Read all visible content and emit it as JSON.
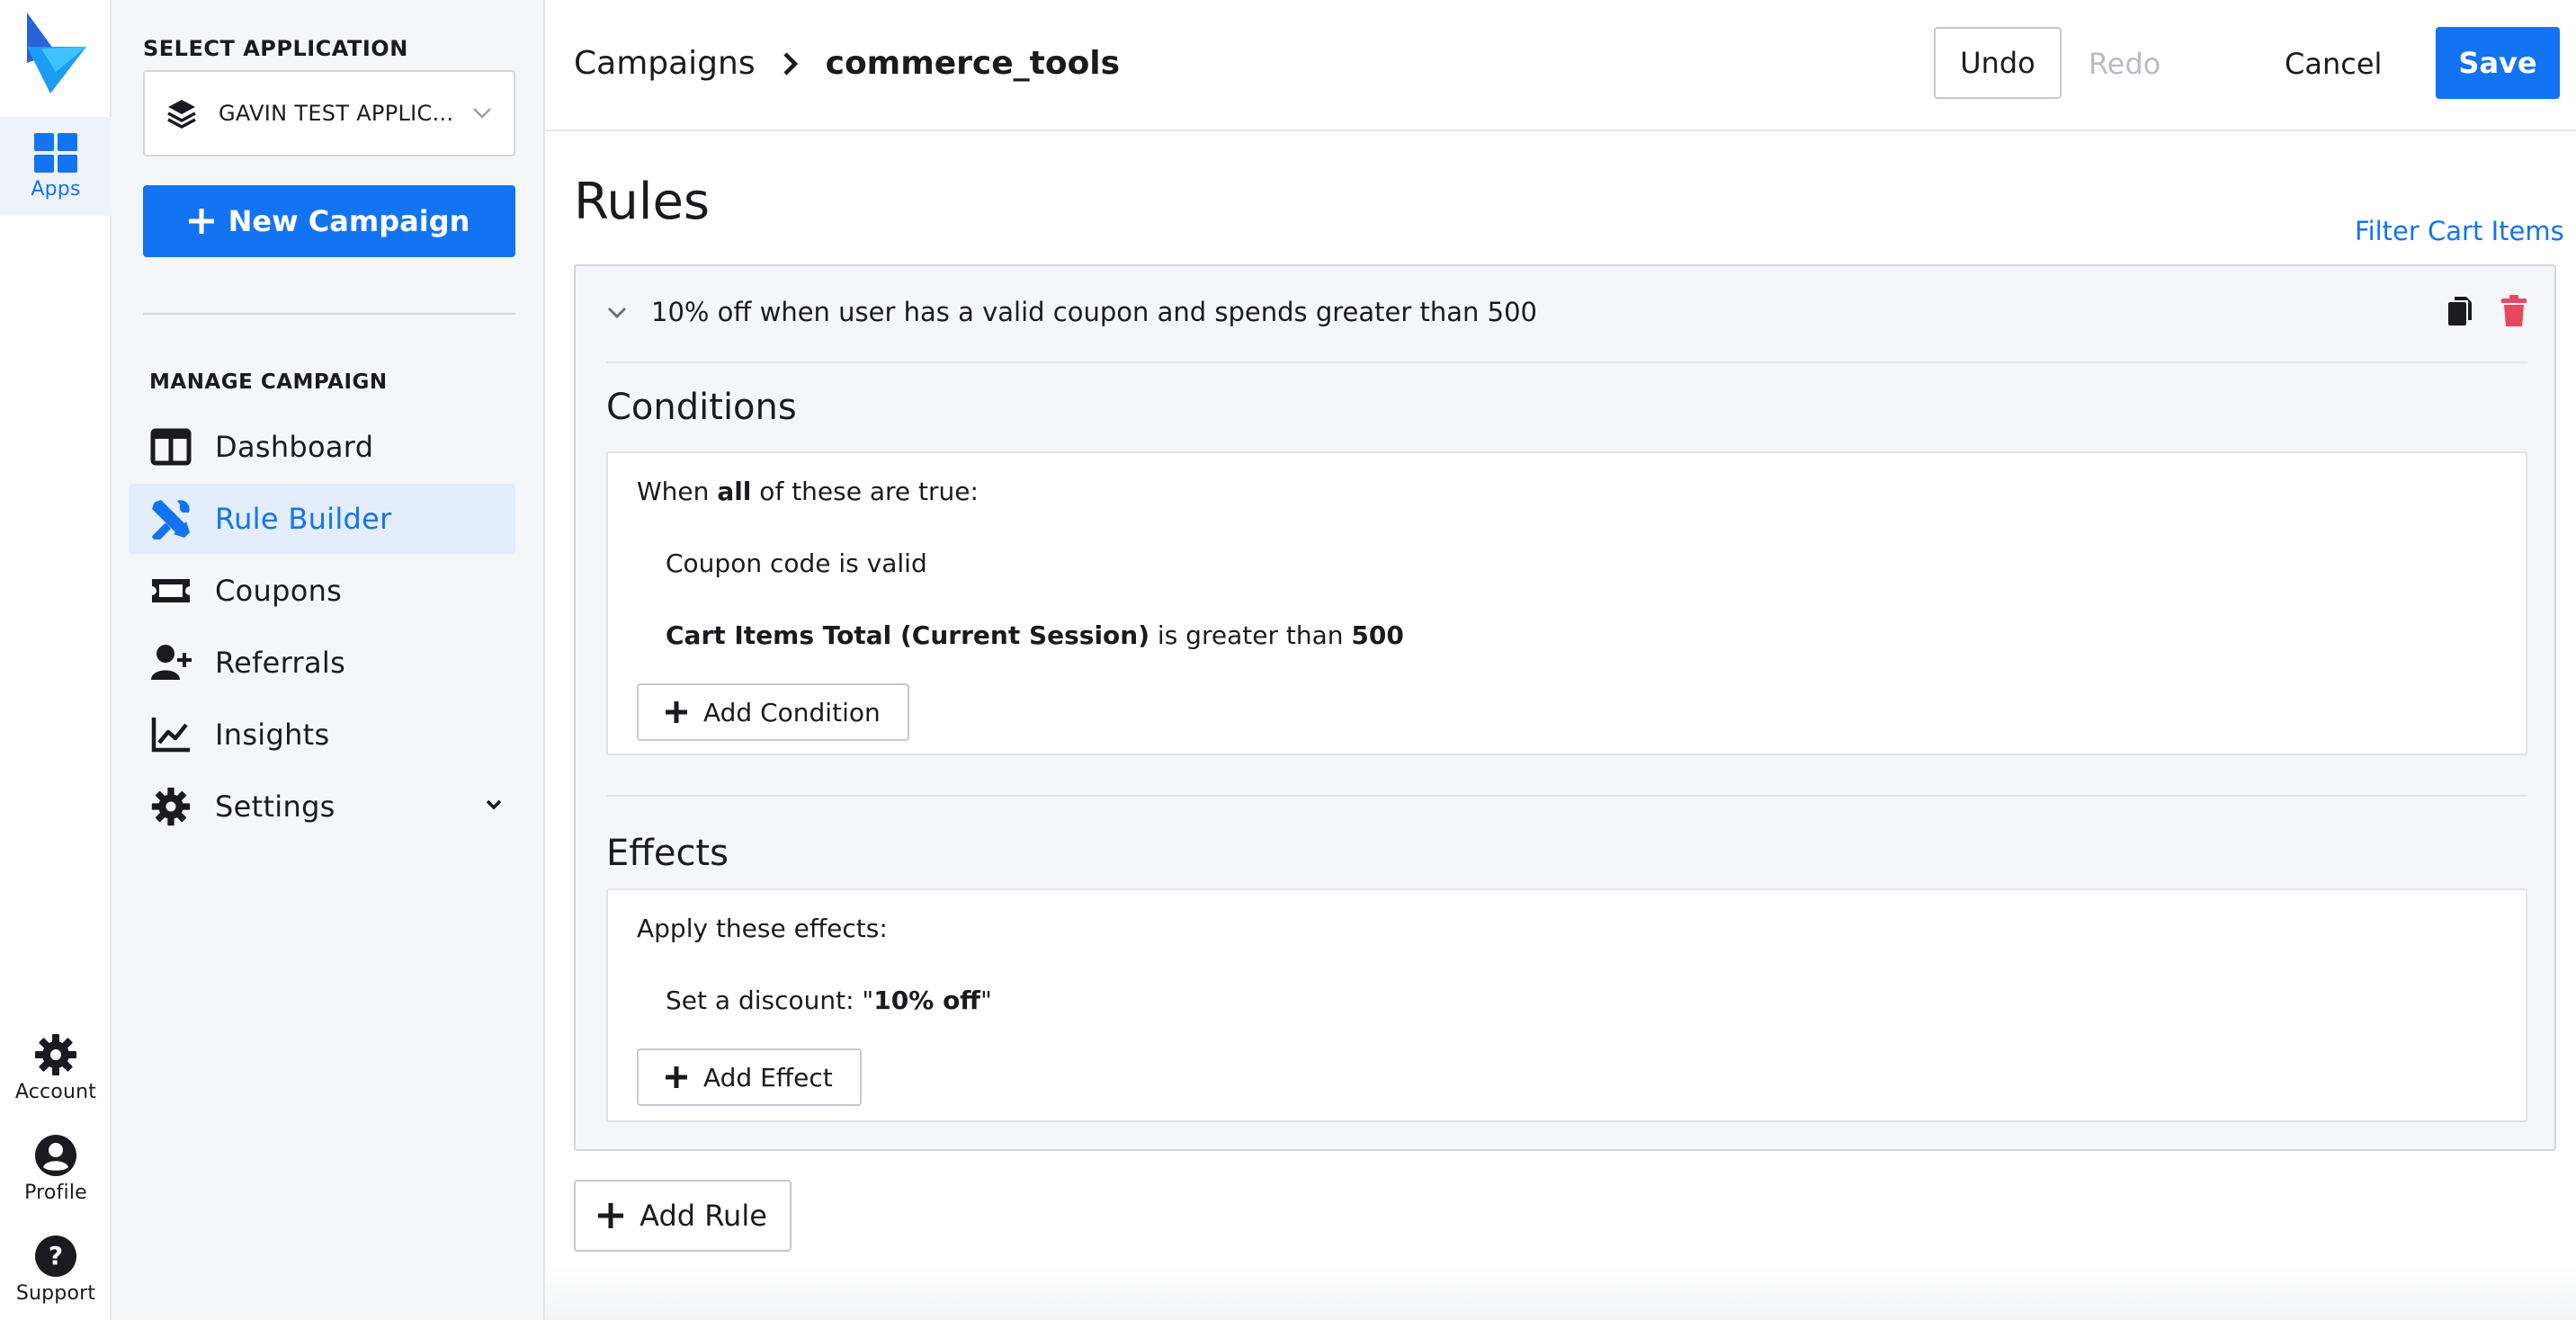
{
  "rail": {
    "apps_label": "Apps",
    "account_label": "Account",
    "profile_label": "Profile",
    "support_label": "Support"
  },
  "sidenav": {
    "select_label": "SELECT APPLICATION",
    "selected_app": "GAVIN TEST APPLIC...",
    "new_campaign": "New Campaign",
    "manage_label": "MANAGE CAMPAIGN",
    "items": [
      {
        "label": "Dashboard",
        "icon": "dashboard-icon"
      },
      {
        "label": "Rule Builder",
        "icon": "tools-icon",
        "active": true
      },
      {
        "label": "Coupons",
        "icon": "ticket-icon"
      },
      {
        "label": "Referrals",
        "icon": "user-plus-icon"
      },
      {
        "label": "Insights",
        "icon": "chart-line-icon"
      },
      {
        "label": "Settings",
        "icon": "gear-icon"
      }
    ]
  },
  "header": {
    "breadcrumb_parent": "Campaigns",
    "breadcrumb_current": "commerce_tools",
    "undo": "Undo",
    "redo": "Redo",
    "cancel": "Cancel",
    "save": "Save"
  },
  "main": {
    "title": "Rules",
    "filter_link": "Filter Cart Items",
    "rule": {
      "title": "10% off when user has a valid coupon and spends greater than 500",
      "conditions": {
        "heading": "Conditions",
        "intro_pre": "When ",
        "intro_bold": "all",
        "intro_post": " of these are true:",
        "line1": "Coupon code is valid",
        "line2_bold": "Cart Items Total (Current Session)",
        "line2_mid": " is greater than ",
        "line2_value": "500",
        "add_button": "Add Condition"
      },
      "effects": {
        "heading": "Effects",
        "intro": "Apply these effects:",
        "line1_pre": "Set a discount: \"",
        "line1_bold": "10% off",
        "line1_post": "\"",
        "add_button": "Add Effect"
      }
    },
    "add_rule": "Add Rule"
  },
  "colors": {
    "accent": "#1274f2",
    "danger": "#e8485b",
    "active_bg": "#e3edfb"
  }
}
